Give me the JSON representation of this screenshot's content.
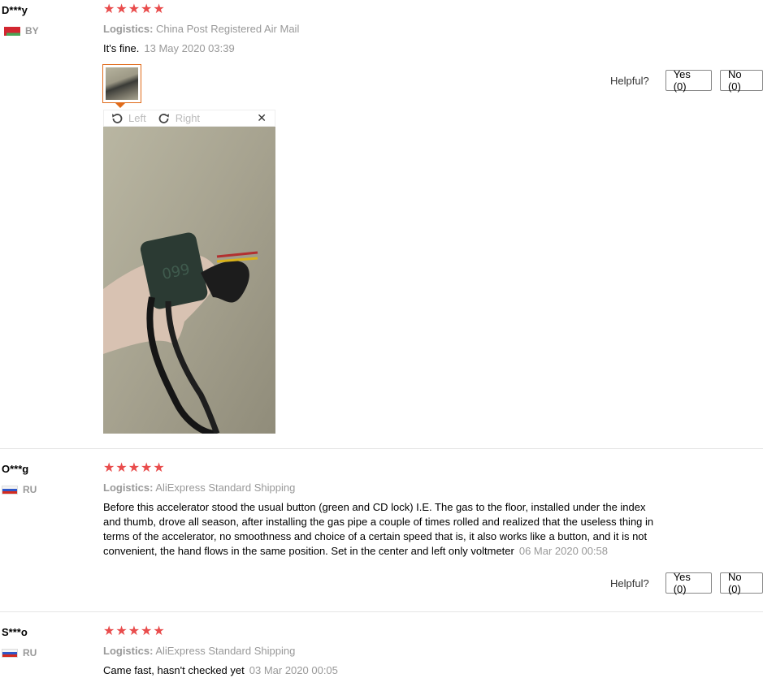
{
  "reviews": [
    {
      "user": "D***y",
      "country": "BY",
      "stars": "★★★★★",
      "logistics_label": "Logistics:",
      "logistics": "China Post Registered Air Mail",
      "text": "It's fine.",
      "date": "13 May 2020 03:39",
      "helpful_label": "Helpful?",
      "yes": "Yes (0)",
      "no": "No (0)",
      "viewer": {
        "left": "Left",
        "right": "Right",
        "close": "✕"
      }
    },
    {
      "user": "O***g",
      "country": "RU",
      "stars": "★★★★★",
      "logistics_label": "Logistics:",
      "logistics": "AliExpress Standard Shipping",
      "text_lines": [
        "Before this accelerator stood the usual button (green and CD lock) I.E. The gas to the floor, installed under the index",
        "and thumb, drove all season, after installing the gas pipe a couple of times rolled and realized that the useless thing in",
        "terms of the accelerator, no smoothness and choice of a certain speed that is, it also works like a button, and it is not",
        "convenient, the hand flows in the same position. Set in the center and left only voltmeter"
      ],
      "date": "06 Mar 2020 00:58",
      "helpful_label": "Helpful?",
      "yes": "Yes (0)",
      "no": "No (0)"
    },
    {
      "user": "S***o",
      "country": "RU",
      "stars": "★★★★★",
      "logistics_label": "Logistics:",
      "logistics": "AliExpress Standard Shipping",
      "text": "Came fast, hasn't checked yet",
      "date": "03 Mar 2020 00:05"
    }
  ],
  "colors": {
    "star": "#e94c4c",
    "thumb_border": "#e06b1a",
    "muted": "#999999"
  },
  "icons": [
    "rotate-left-icon",
    "rotate-right-icon",
    "close-icon",
    "flag-by-icon",
    "flag-ru-icon",
    "star-icon"
  ]
}
